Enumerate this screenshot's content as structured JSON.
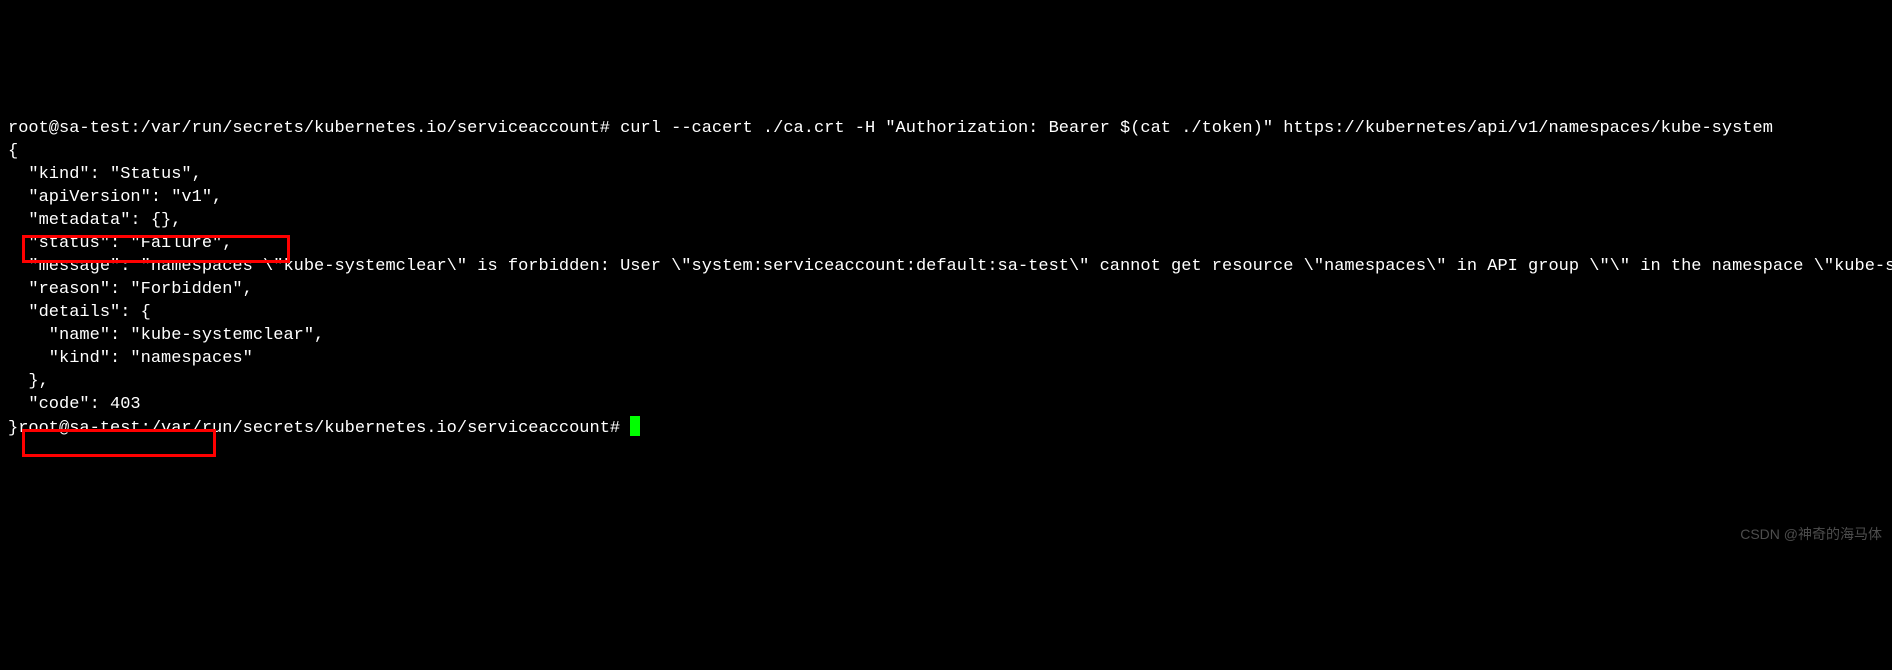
{
  "terminal": {
    "prompt1": "root@sa-test:/var/run/secrets/kubernetes.io/serviceaccount# ",
    "command": "curl --cacert ./ca.crt -H \"Authorization: Bearer $(cat ./token)\" https://kubernetes/api/v1/namespaces/kube-system",
    "output": {
      "line1": "{",
      "line2": "  \"kind\": \"Status\",",
      "line3": "  \"apiVersion\": \"v1\",",
      "line4": "  \"metadata\": {},",
      "line5": "  \"status\": \"Failure\",",
      "line6": "  \"message\": \"namespaces \\\"kube-systemclear\\\" is forbidden: User \\\"system:serviceaccount:default:sa-test\\\" cannot get resource \\\"namespaces\\\" in API group \\\"\\\" in the namespace \\\"kube-systemclear\\\"\",",
      "line7": "  \"reason\": \"Forbidden\",",
      "line8": "  \"details\": {",
      "line9": "    \"name\": \"kube-systemclear\",",
      "line10": "    \"kind\": \"namespaces\"",
      "line11": "  },",
      "line12": "  \"code\": 403",
      "line13_prefix": "}",
      "prompt2": "root@sa-test:/var/run/secrets/kubernetes.io/serviceaccount# "
    }
  },
  "watermark": "CSDN @神奇的海马体"
}
